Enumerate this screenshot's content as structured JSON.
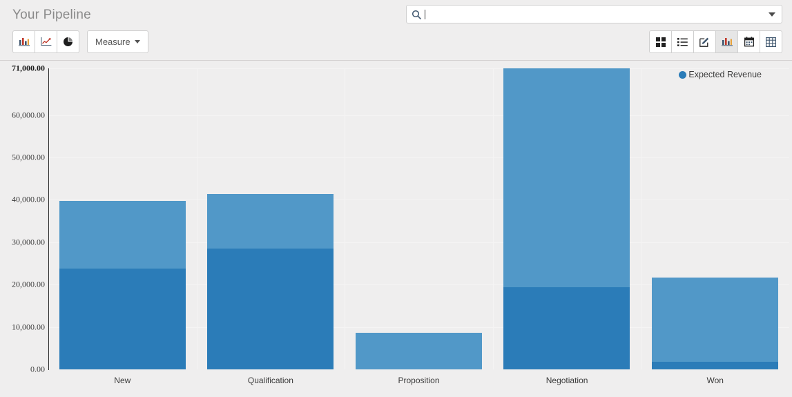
{
  "header": {
    "title": "Your Pipeline",
    "search": {
      "icon": "search-icon",
      "value": "",
      "placeholder": "",
      "toggle_icon": "chevron-down-icon"
    },
    "left_buttons": [
      {
        "name": "bar-chart-button",
        "icon": "bar-chart-icon",
        "label": "",
        "active": false
      },
      {
        "name": "line-chart-button",
        "icon": "line-chart-icon",
        "label": "",
        "active": false
      },
      {
        "name": "pie-chart-button",
        "icon": "pie-chart-icon",
        "label": "",
        "active": false
      }
    ],
    "measure_button": {
      "label": "Measure",
      "caret": "caret-down-icon"
    },
    "view_switcher": [
      {
        "name": "view-kanban",
        "icon": "kanban-icon",
        "active": false
      },
      {
        "name": "view-list",
        "icon": "list-icon",
        "active": false
      },
      {
        "name": "view-form",
        "icon": "pencil-icon",
        "active": false
      },
      {
        "name": "view-graph",
        "icon": "bar-chart-icon",
        "active": true
      },
      {
        "name": "view-calendar",
        "icon": "calendar-icon",
        "active": false
      },
      {
        "name": "view-pivot",
        "icon": "table-icon",
        "active": false
      }
    ]
  },
  "colors": {
    "bar_dark": "#2b7cb8",
    "bar_light": "#5198c8",
    "plot_background": "#efeeee",
    "gridline": "#f5f4f4",
    "axis": "#2b2b2b",
    "active_button": "#e6e6e6"
  },
  "chart_data": {
    "type": "bar",
    "stacked": true,
    "title": "Your Pipeline",
    "xlabel": "",
    "ylabel": "",
    "ylim": [
      0,
      71000
    ],
    "grid": true,
    "legend_position": "top-right",
    "categories": [
      "New",
      "Qualification",
      "Proposition",
      "Negotiation",
      "Won"
    ],
    "ytick_labels": [
      "0.00",
      "10,000.00",
      "20,000.00",
      "30,000.00",
      "40,000.00",
      "50,000.00",
      "60,000.00",
      "71,000.00"
    ],
    "ytick_values": [
      0,
      10000,
      20000,
      30000,
      40000,
      50000,
      60000,
      71000
    ],
    "legend": [
      {
        "label": "Expected Revenue",
        "color": "#2b7cb8"
      }
    ],
    "series": [
      {
        "name": "Expected Revenue (lower segment)",
        "color": "#2b7cb8",
        "values": [
          23800,
          28600,
          0,
          19400,
          1800
        ]
      },
      {
        "name": "Expected Revenue (upper segment)",
        "color": "#5198c8",
        "values": [
          16000,
          12800,
          8700,
          51600,
          19900
        ]
      }
    ],
    "totals": [
      39800,
      41400,
      8700,
      71000,
      21700
    ]
  }
}
